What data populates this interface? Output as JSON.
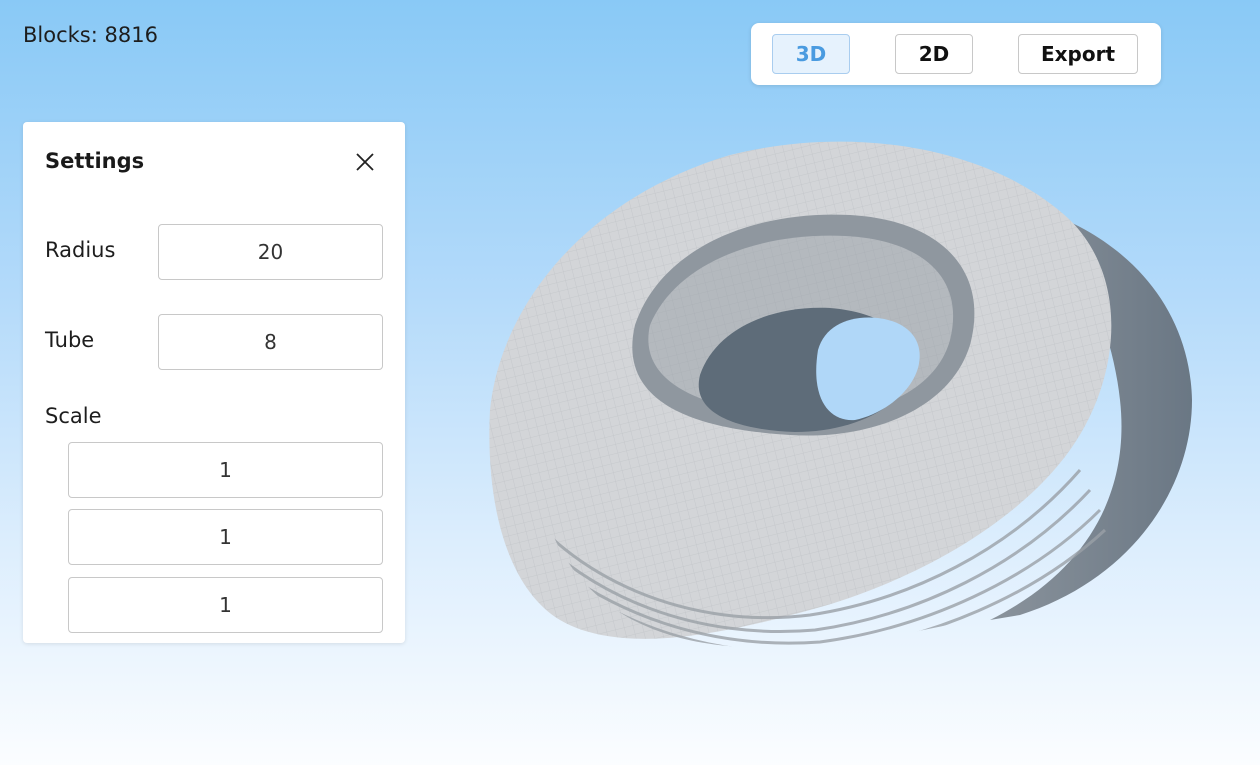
{
  "status": {
    "blocks_label": "Blocks:",
    "blocks_count": "8816"
  },
  "toolbar": {
    "buttons": [
      {
        "label": "3D",
        "active": true
      },
      {
        "label": "2D",
        "active": false
      },
      {
        "label": "Export",
        "active": false
      }
    ]
  },
  "settings": {
    "title": "Settings",
    "close_icon": "close-icon",
    "radius_label": "Radius",
    "radius_value": "20",
    "tube_label": "Tube",
    "tube_value": "8",
    "scale_label": "Scale",
    "scale_x": "1",
    "scale_y": "1",
    "scale_z": "1"
  },
  "theme": {
    "accent": "#4a9be0",
    "active_bg": "#e6f2fd",
    "voxel_top": "#d4d6d9",
    "voxel_side": "#7b8590",
    "voxel_shadow": "#5f6c78"
  }
}
